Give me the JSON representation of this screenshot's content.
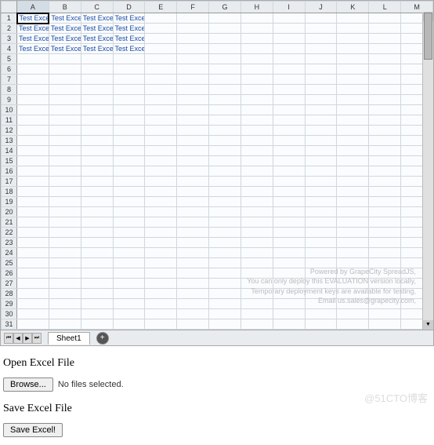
{
  "columns": [
    "A",
    "B",
    "C",
    "D",
    "E",
    "F",
    "G",
    "H",
    "I",
    "J",
    "K",
    "L",
    "M"
  ],
  "rowCount": 31,
  "activeCell": {
    "row": 1,
    "col": 0
  },
  "activeColumn": "A",
  "cells": {
    "1": [
      "Test Excel",
      "Test Excel",
      "Test Excel",
      "Test Excel"
    ],
    "2": [
      "Test Excel",
      "Test Excel",
      "Test Excel",
      "Test Excel"
    ],
    "3": [
      "Test Excel",
      "Test Excel",
      "Test Excel",
      "Test Excel"
    ],
    "4": [
      "Test Excel",
      "Test Excel",
      "Test Excel",
      "Test Excel"
    ]
  },
  "watermark": {
    "line1": "Powered by GrapeCity SpreadJS,",
    "line2": "You can only deploy this EVALUATION version locally,",
    "line3": "Temporary deployment keys are available for testing,",
    "line4": "Email us.sales@grapecity.com,"
  },
  "sheetTab": "Sheet1",
  "addSheetIcon": "+",
  "nav": {
    "first": "⏮",
    "prev": "◀",
    "next": "▶",
    "last": "⏭"
  },
  "openLabel": "Open Excel File",
  "browseLabel": "Browse...",
  "fileStatus": "No files selected.",
  "saveLabel": "Save Excel File",
  "saveButton": "Save Excel!",
  "blogMark": "@51CTO博客"
}
